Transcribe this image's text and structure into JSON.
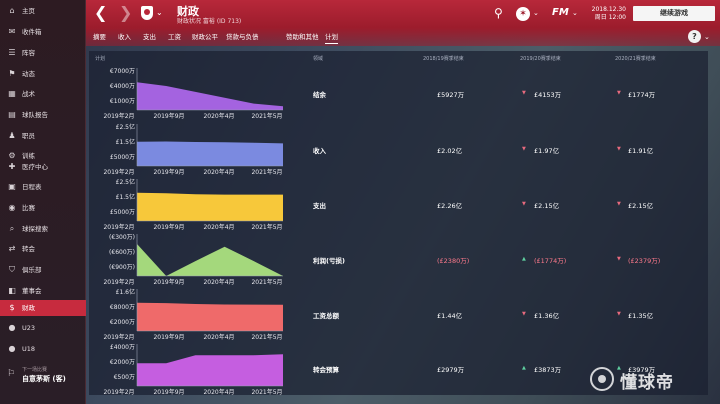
{
  "header": {
    "title": "财政",
    "subtitle": "财政状况 富裕 (ID 713)",
    "date_line1": "2018.12.30",
    "date_line2": "周日 12:00",
    "continue_label": "继续游戏",
    "fm_label": "FM",
    "help_label": "?"
  },
  "sidebar": {
    "items": [
      {
        "label": "主页",
        "icon": "home-icon"
      },
      {
        "label": "收件箱",
        "icon": "inbox-icon"
      },
      {
        "label": "阵容",
        "icon": "squad-icon"
      },
      {
        "label": "动态",
        "icon": "dynamics-icon"
      },
      {
        "label": "战术",
        "icon": "tactics-icon"
      },
      {
        "label": "球队报告",
        "icon": "report-icon"
      },
      {
        "label": "职员",
        "icon": "staff-icon"
      },
      {
        "label": "训练",
        "icon": "training-icon"
      },
      {
        "label": "医疗中心",
        "icon": "medical-icon"
      },
      {
        "label": "日程表",
        "icon": "calendar-icon"
      },
      {
        "label": "比赛",
        "icon": "match-icon"
      },
      {
        "label": "球探搜索",
        "icon": "scouting-icon"
      },
      {
        "label": "转会",
        "icon": "transfer-icon"
      },
      {
        "label": "俱乐部",
        "icon": "club-icon"
      },
      {
        "label": "董事会",
        "icon": "board-icon"
      },
      {
        "label": "财政",
        "icon": "finance-icon"
      },
      {
        "label": "U23",
        "icon": "u23-icon"
      },
      {
        "label": "U18",
        "icon": "u18-icon"
      }
    ],
    "active_index": 15,
    "next_label": "下一场比赛",
    "next_name": "自意茅斯 (客)"
  },
  "tabs": [
    "摘要",
    "收入",
    "支出",
    "工资",
    "财政公平",
    "贷款与负债",
    "赞助和其他",
    "计划"
  ],
  "active_tab": 7,
  "table": {
    "headers": [
      "计划",
      "领域",
      "2018/19赛季结束",
      "2019/20赛季结束",
      "2020/21赛季结束"
    ],
    "rows": [
      {
        "label": "结余",
        "v1": "£5927万",
        "v2": "£4153万",
        "v3": "£1774万",
        "t2": "down",
        "t3": "down",
        "neg": [
          false,
          false,
          false
        ]
      },
      {
        "label": "收入",
        "v1": "£2.02亿",
        "v2": "£1.97亿",
        "v3": "£1.91亿",
        "t2": "down",
        "t3": "down",
        "neg": [
          false,
          false,
          false
        ]
      },
      {
        "label": "支出",
        "v1": "£2.26亿",
        "v2": "£2.15亿",
        "v3": "£2.15亿",
        "t2": "down",
        "t3": "down",
        "neg": [
          false,
          false,
          false
        ]
      },
      {
        "label": "利润(亏损)",
        "v1": "(£2380万)",
        "v2": "(£1774万)",
        "v3": "(£2379万)",
        "t2": "up",
        "t3": "down",
        "neg": [
          true,
          true,
          true
        ]
      },
      {
        "label": "工资总额",
        "v1": "£1.44亿",
        "v2": "£1.36亿",
        "v3": "£1.35亿",
        "t2": "down",
        "t3": "down",
        "neg": [
          false,
          false,
          false
        ]
      },
      {
        "label": "转会预算",
        "v1": "£2979万",
        "v2": "£3873万",
        "v3": "£3979万",
        "t2": "up",
        "t3": "up",
        "neg": [
          false,
          false,
          false
        ]
      }
    ]
  },
  "mini_charts": [
    {
      "color": "#a463e0",
      "ticks": [
        "€7000万",
        "€4000万",
        "€1000万"
      ],
      "values": [
        6200,
        5500,
        4400,
        3300,
        2200,
        1700
      ],
      "ymin": 1000,
      "ymax": 7000
    },
    {
      "color": "#7b8ae0",
      "ticks": [
        "£2.5亿",
        "£1.5亿",
        "£5000万"
      ],
      "values": [
        2.02,
        2.03,
        2.0,
        1.98,
        1.95,
        1.91
      ],
      "ymin": 0.5,
      "ymax": 2.5
    },
    {
      "color": "#f7c83a",
      "ticks": [
        "£2.5亿",
        "£1.5亿",
        "£5000万"
      ],
      "values": [
        2.26,
        2.24,
        2.17,
        2.15,
        2.15,
        2.15
      ],
      "ymin": 0.5,
      "ymax": 2.5
    },
    {
      "color": "#a4d87c",
      "ticks": [
        "(€300万)",
        "(€600万)",
        "(€900万)"
      ],
      "values": [
        -300,
        -900,
        -620,
        -350,
        -620,
        -900
      ],
      "ymin": -900,
      "ymax": -300
    },
    {
      "color": "#ef6a6a",
      "ticks": [
        "£1.6亿",
        "€8000万",
        "€2000万"
      ],
      "values": [
        1.44,
        1.42,
        1.38,
        1.36,
        1.355,
        1.35
      ],
      "ymin": 0.2,
      "ymax": 1.6
    },
    {
      "color": "#c55ee0",
      "ticks": [
        "£4000万",
        "€2000万",
        "€500万"
      ],
      "values": [
        2979,
        2979,
        3873,
        3873,
        3873,
        3979
      ],
      "ymin": 500,
      "ymax": 4000
    }
  ],
  "x_labels": [
    "2019年2月",
    "2019年9月",
    "2020年4月",
    "2021年5月"
  ],
  "watermark": "懂球帝"
}
